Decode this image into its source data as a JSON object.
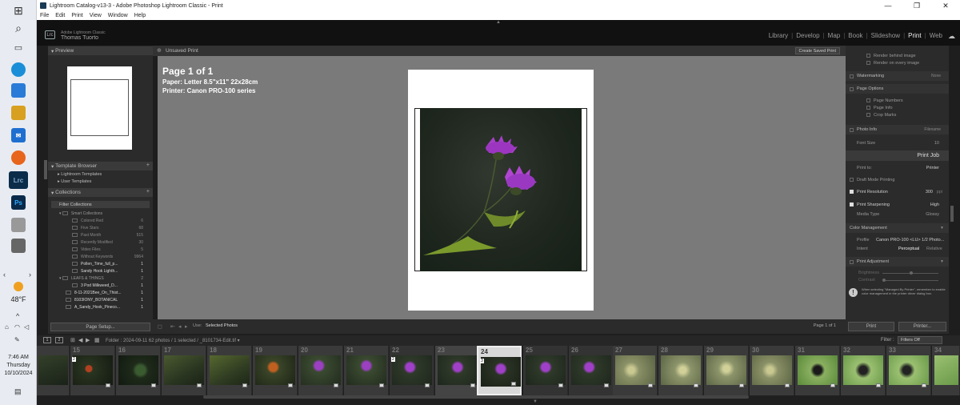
{
  "window": {
    "title": "Lightroom Catalog-v13-3 - Adobe Photoshop Lightroom Classic - Print",
    "minimize": "—",
    "maximize": "❐",
    "close": "✕"
  },
  "menu": [
    "File",
    "Edit",
    "Print",
    "View",
    "Window",
    "Help"
  ],
  "identity": {
    "badge": "Lrc",
    "product": "Adobe Lightroom Classic",
    "user": "Thomas Tuorto"
  },
  "modules": [
    "Library",
    "Develop",
    "Map",
    "Book",
    "Slideshow",
    "Print",
    "Web"
  ],
  "active_module": "Print",
  "left_panel": {
    "preview_header": "Preview",
    "template_browser_header": "Template Browser",
    "template_items": [
      "Lightroom Templates",
      "User Templates"
    ],
    "collections_header": "Collections",
    "filter_label": "Filter Collections",
    "collection_rows": [
      {
        "label": "Smart Collections",
        "count": ""
      },
      {
        "label": "Colored Red",
        "count": "6"
      },
      {
        "label": "Five Stars",
        "count": "68"
      },
      {
        "label": "Past Month",
        "count": "515"
      },
      {
        "label": "Recently Modified",
        "count": "30"
      },
      {
        "label": "Video Files",
        "count": "5"
      },
      {
        "label": "Without Keywords",
        "count": "9964"
      },
      {
        "label": "Pollen_Time_full_p...",
        "count": "1"
      },
      {
        "label": "Sandy Hook Lighth...",
        "count": "1"
      },
      {
        "label": "LEAFS & THINGS",
        "count": "2"
      },
      {
        "label": "3 Pod Milkweed_D...",
        "count": "1"
      },
      {
        "label": "8-11-2021Bee_On_Thist...",
        "count": "1"
      },
      {
        "label": "8103IONY_BOTANICAL",
        "count": "1"
      },
      {
        "label": "A_Sandy_Hook_Pineco...",
        "count": "1"
      }
    ],
    "page_setup_button": "Page Setup..."
  },
  "center": {
    "title": "Unsaved Print",
    "create_saved_button": "Create Saved Print",
    "page_label": "Page 1 of 1",
    "paper_label": "Paper:  Letter 8.5\"x11\" 22x28cm",
    "printer_label": "Printer:  Canon PRO-100 series",
    "use_label": "Use:",
    "use_value": "Selected Photos",
    "page_count": "Page 1 of 1"
  },
  "right_panel": {
    "rows_top": [
      "Render behind image",
      "Render on every image"
    ],
    "watermarking": "Watermarking",
    "watermark_value": "None",
    "page_options": "Page Options",
    "page_option_items": [
      "Page Numbers",
      "Page Info",
      "Crop Marks"
    ],
    "photo_info": "Photo Info",
    "photo_info_value": "Filename",
    "font_size_label": "Font Size",
    "font_size_value": "10",
    "print_job_header": "Print Job",
    "print_to_label": "Print to:",
    "print_to_value": "Printer",
    "draft_mode": "Draft Mode Printing",
    "print_resolution": "Print Resolution",
    "print_resolution_value": "300",
    "print_resolution_unit": "ppi",
    "print_sharpening": "Print Sharpening",
    "sharpening_value": "High",
    "media_type_label": "Media Type",
    "media_type_value": "Glossy",
    "color_management": "Color Management",
    "profile_label": "Profile",
    "profile_value": "Canon PRO-100 <LU> 1/2 Photo...",
    "intent_label": "Intent",
    "intent_perceptual": "Perceptual",
    "intent_relative": "Relative",
    "print_adjustment": "Print Adjustment",
    "brightness_label": "Brightness",
    "contrast_label": "Contrast",
    "info_text": "When selecting \"Managed By Printer\", remember to enable color management in the printer driver dialog box.",
    "print_button": "Print",
    "printer_button": "Printer..."
  },
  "filmstrip": {
    "crumb": "Folder : 2024-09-11    62 photos / 1 selected / _8101734-Edit.tif ▾",
    "filter_label": "Filter :",
    "filter_value": "Filters Off",
    "numbers": [
      "",
      "15",
      "16",
      "17",
      "18",
      "19",
      "20",
      "21",
      "22",
      "23",
      "24",
      "25",
      "26",
      "27",
      "28",
      "29",
      "30",
      "31",
      "32",
      "33",
      "34"
    ],
    "flags": [
      "2",
      "2",
      "3"
    ]
  },
  "taskbar": {
    "temp": "48°F",
    "time": "7:46 AM",
    "day": "Thursday",
    "date": "10/10/2024"
  }
}
